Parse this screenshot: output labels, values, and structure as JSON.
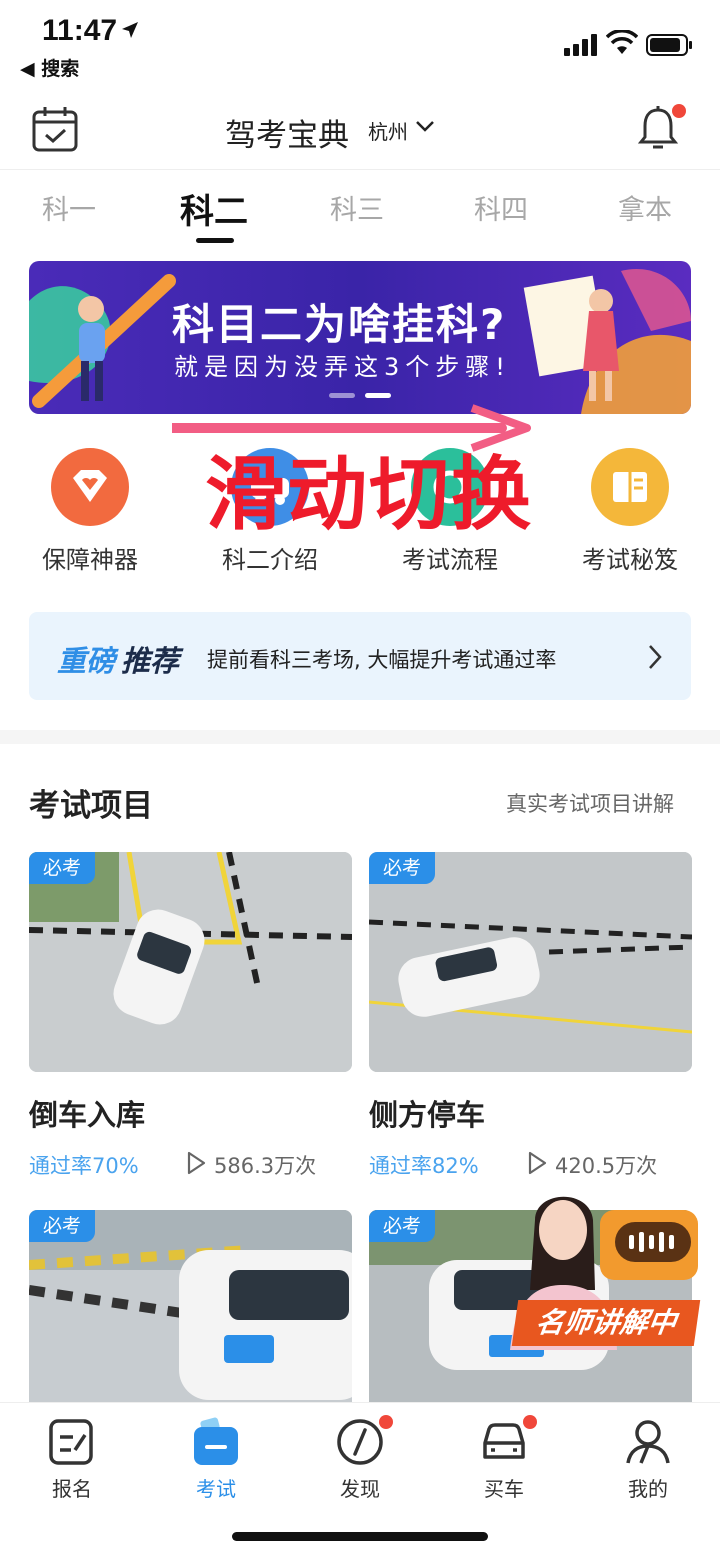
{
  "status": {
    "time": "11:47",
    "back_label": "◀ 搜索"
  },
  "header": {
    "title": "驾考宝典",
    "city": "杭州"
  },
  "tabs": [
    {
      "label": "科一"
    },
    {
      "label": "科二"
    },
    {
      "label": "科三"
    },
    {
      "label": "科四"
    },
    {
      "label": "拿本"
    }
  ],
  "banner": {
    "title": "科目二为啥挂科?",
    "subtitle": "就是因为没弄这3个步骤!"
  },
  "overlay": {
    "swipe_text": "滑动切换"
  },
  "quick_icons": [
    {
      "label": "保障神器",
      "icon": "shield-heart-icon",
      "color": "#f26a3f"
    },
    {
      "label": "科二介绍",
      "icon": "car-info-icon",
      "color": "#3f8ee6"
    },
    {
      "label": "考试流程",
      "icon": "flow-icon",
      "color": "#2bbf9b"
    },
    {
      "label": "考试秘笈",
      "icon": "book-icon",
      "color": "#f4b73a"
    }
  ],
  "recommend": {
    "tag_part1": "重磅",
    "tag_part2": "推荐",
    "text": "提前看科三考场, 大幅提升考试通过率"
  },
  "section": {
    "title": "考试项目",
    "link": "真实考试项目讲解"
  },
  "cards": [
    {
      "badge": "必考",
      "title": "倒车入库",
      "rate": "通过率70%",
      "views": "586.3万次"
    },
    {
      "badge": "必考",
      "title": "侧方停车",
      "rate": "通过率82%",
      "views": "420.5万次"
    },
    {
      "badge": "必考"
    },
    {
      "badge": "必考"
    }
  ],
  "teacher": {
    "label": "名师讲解中"
  },
  "bottom_nav": [
    {
      "label": "报名",
      "icon": "signup-icon"
    },
    {
      "label": "考试",
      "icon": "exam-icon"
    },
    {
      "label": "发现",
      "icon": "compass-icon"
    },
    {
      "label": "买车",
      "icon": "car-icon"
    },
    {
      "label": "我的",
      "icon": "profile-icon"
    }
  ],
  "colors": {
    "accent": "#2b8fe8",
    "badge_red": "#f0473a",
    "overlay_red": "#ee1b2b"
  }
}
